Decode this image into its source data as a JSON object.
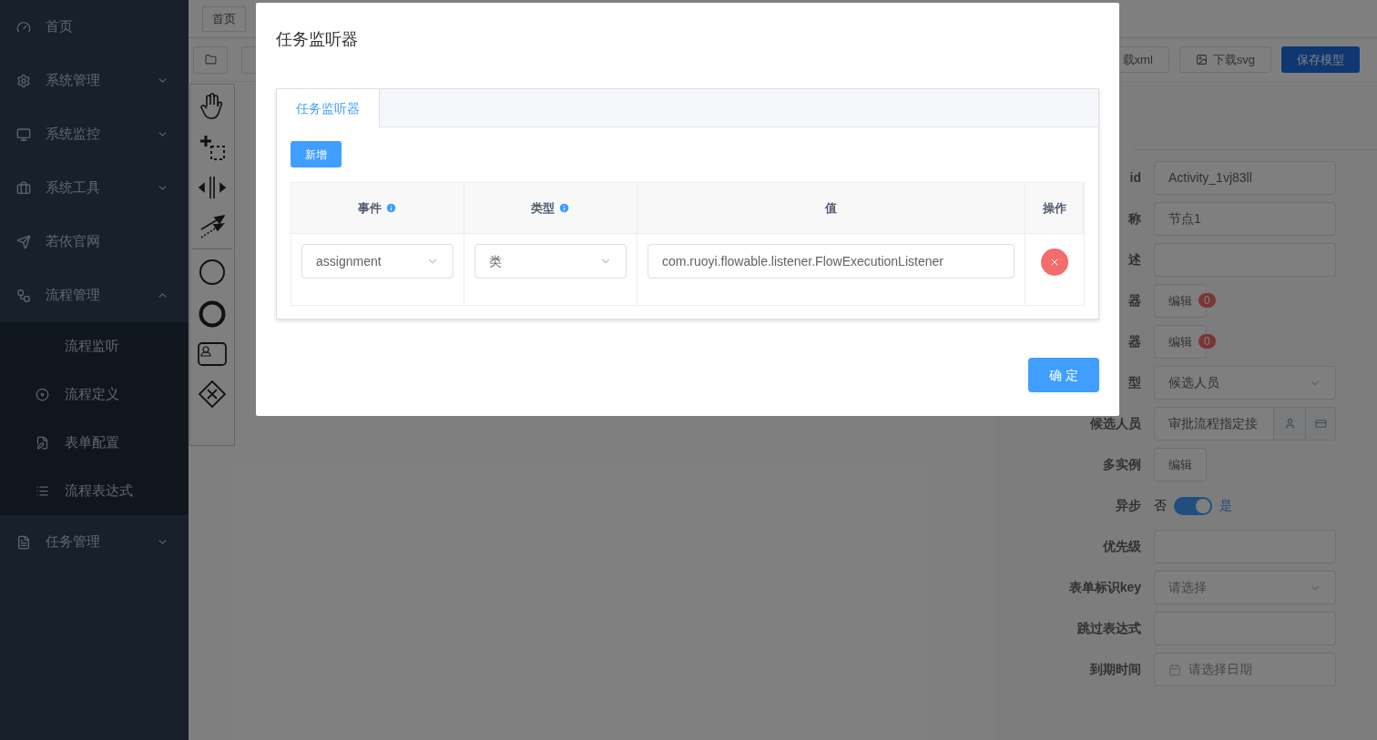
{
  "sidebar": {
    "items": [
      {
        "label": "首页"
      },
      {
        "label": "系统管理",
        "expanded": false
      },
      {
        "label": "系统监控",
        "expanded": false
      },
      {
        "label": "系统工具",
        "expanded": false
      },
      {
        "label": "若依官网"
      },
      {
        "label": "流程管理",
        "expanded": true,
        "children": [
          {
            "label": "流程监听"
          },
          {
            "label": "流程定义"
          },
          {
            "label": "表单配置"
          },
          {
            "label": "流程表达式"
          }
        ]
      },
      {
        "label": "任务管理",
        "expanded": false
      }
    ]
  },
  "tags": [
    {
      "label": "首页"
    }
  ],
  "toolbar": {
    "buttons": [
      {
        "label": "载xml"
      },
      {
        "label": "下载svg"
      },
      {
        "label": "保存模型",
        "kind": "primary"
      }
    ]
  },
  "properties": [
    {
      "label": "id",
      "kind": "input",
      "value": "Activity_1vj83ll"
    },
    {
      "label": "称",
      "kind": "input",
      "value": "节点1"
    },
    {
      "label": "述",
      "kind": "input"
    },
    {
      "label": "器",
      "kind": "edit",
      "button": "编辑",
      "badge": "0"
    },
    {
      "label": "器",
      "kind": "edit",
      "button": "编辑",
      "badge": "0"
    },
    {
      "label": "型",
      "kind": "select",
      "value": "候选人员"
    },
    {
      "label": "候选人员",
      "kind": "picker",
      "value": "审批流程指定接"
    },
    {
      "label": "多实例",
      "kind": "edit",
      "button": "编辑"
    },
    {
      "label": "异步",
      "kind": "switch",
      "off_label": "否",
      "on_label": "是",
      "on": true
    },
    {
      "label": "优先级",
      "kind": "input"
    },
    {
      "label": "表单标识key",
      "kind": "select",
      "placeholder": "请选择"
    },
    {
      "label": "跳过表达式",
      "kind": "input"
    },
    {
      "label": "到期时间",
      "kind": "date",
      "placeholder": "请选择日期"
    }
  ],
  "dialog": {
    "title": "任务监听器",
    "tabs": [
      {
        "label": "任务监听器",
        "selected": true
      }
    ],
    "add_button": "新增",
    "table": {
      "columns": [
        {
          "label": "事件",
          "info": true
        },
        {
          "label": "类型",
          "info": true
        },
        {
          "label": "值"
        },
        {
          "label": "操作"
        }
      ],
      "rows": [
        {
          "event": "assignment",
          "type": "类",
          "value": "com.ruoyi.flowable.listener.FlowExecutionListener"
        }
      ]
    },
    "confirm_button": "确 定"
  }
}
